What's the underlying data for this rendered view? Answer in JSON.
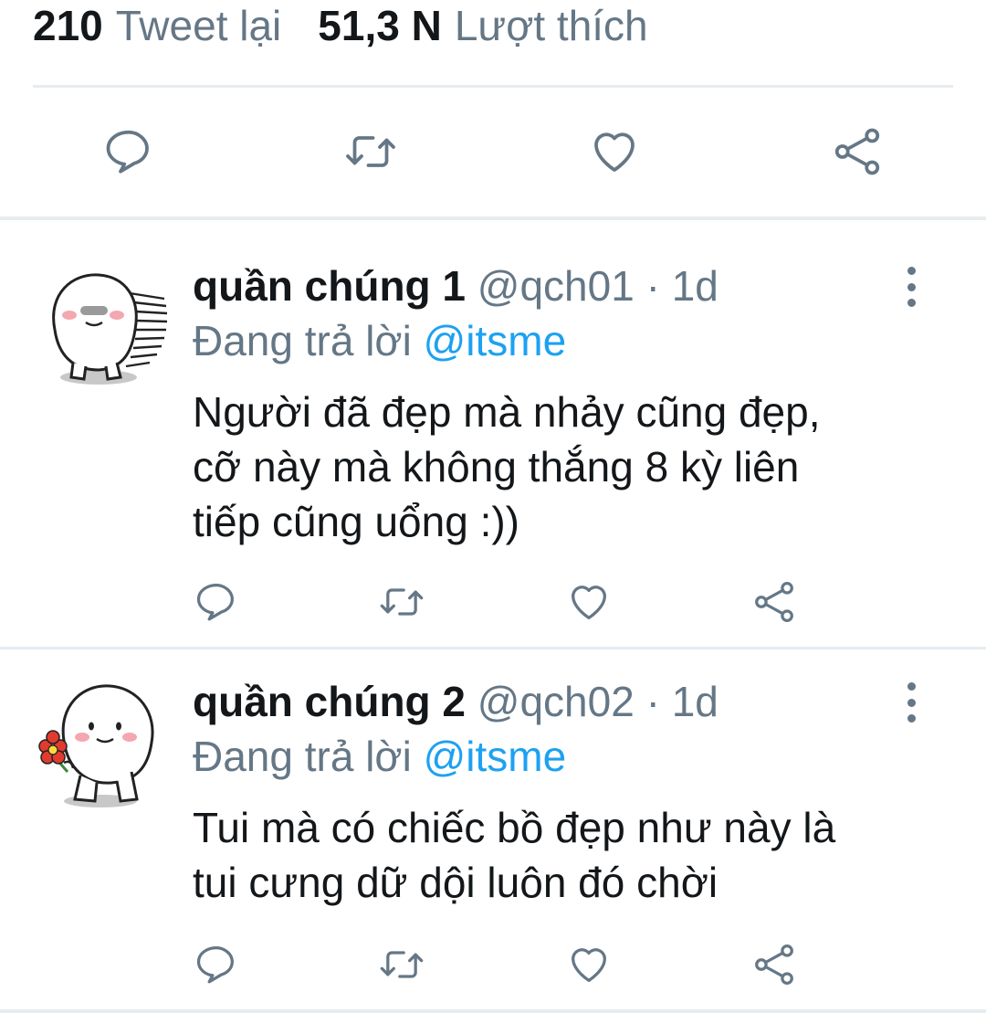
{
  "stats": {
    "retweets_count": "210",
    "retweets_label": "Tweet lại",
    "likes_count": "51,3 N",
    "likes_label": "Lượt thích"
  },
  "main_actions": [
    "reply-icon",
    "retweet-icon",
    "like-icon",
    "share-icon"
  ],
  "colors": {
    "text": "#14171a",
    "muted": "#657786",
    "link": "#1da1f2",
    "divider": "#e6ecf0"
  },
  "replies": [
    {
      "name": "quần chúng 1",
      "handle": "@qch01",
      "separator": "·",
      "time": "1d",
      "replying_label": "Đang trả lời",
      "replying_to": "@itsme",
      "text": "Người đã đẹp mà nhảy cũng đẹp,\ncỡ này mà không thắng 8 kỳ liên\ntiếp cũng uổng :))"
    },
    {
      "name": "quần chúng 2",
      "handle": "@qch02",
      "separator": "·",
      "time": "1d",
      "replying_label": "Đang trả lời",
      "replying_to": "@itsme",
      "text": "Tui mà có chiếc bồ đẹp như này là\ntui cưng dữ dội luôn đó chời"
    }
  ]
}
